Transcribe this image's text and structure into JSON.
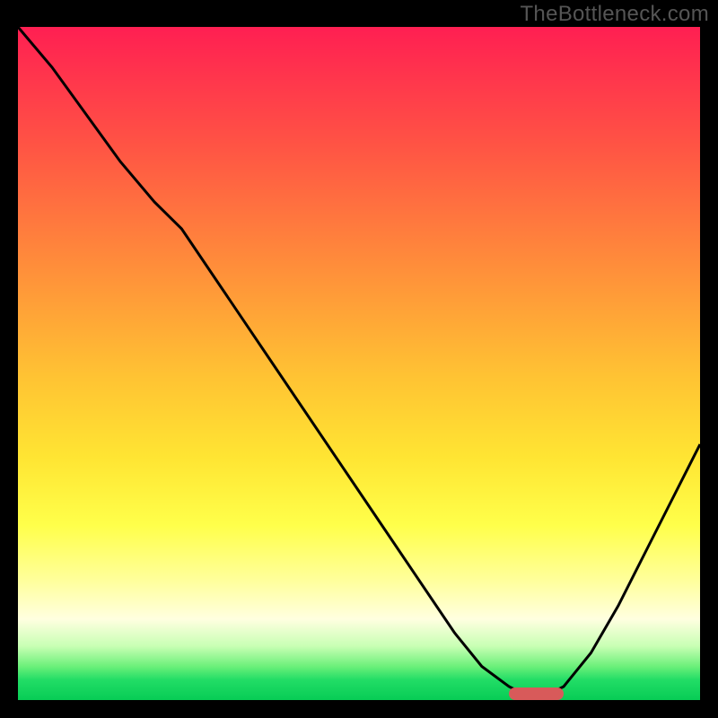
{
  "attribution": "TheBottleneck.com",
  "colors": {
    "top": "#ff1f52",
    "mid1": "#ff8f3a",
    "mid2": "#ffe533",
    "bottom": "#07cc55",
    "curve": "#000000",
    "marker": "#d85a5a",
    "frame": "#000000"
  },
  "chart_data": {
    "type": "line",
    "title": "",
    "xlabel": "",
    "ylabel": "",
    "xlim": [
      0,
      1
    ],
    "ylim": [
      0,
      1
    ],
    "x": [
      0.0,
      0.05,
      0.1,
      0.15,
      0.2,
      0.24,
      0.3,
      0.36,
      0.42,
      0.48,
      0.54,
      0.6,
      0.64,
      0.68,
      0.72,
      0.76,
      0.8,
      0.84,
      0.88,
      0.92,
      0.96,
      1.0
    ],
    "values": [
      1.0,
      0.94,
      0.87,
      0.8,
      0.74,
      0.7,
      0.61,
      0.52,
      0.43,
      0.34,
      0.25,
      0.16,
      0.1,
      0.05,
      0.02,
      0.0,
      0.02,
      0.07,
      0.14,
      0.22,
      0.3,
      0.38
    ],
    "optimum_x_range": [
      0.72,
      0.8
    ]
  }
}
